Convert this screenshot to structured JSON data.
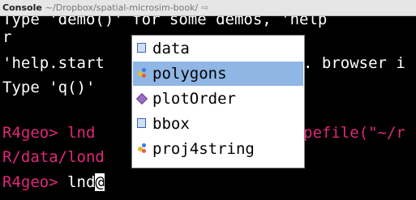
{
  "header": {
    "title": "Console",
    "path": "~/Dropbox/spatial-microsim-book/",
    "goto_icon": "arrow-right-icon"
  },
  "console": {
    "lines": [
      {
        "text": "Type 'demo()' for some demos, 'help",
        "color": "white"
      },
      {
        "text": "r",
        "color": "white"
      },
      {
        "text": "'help.start",
        "tail": ". browser i",
        "color": "white"
      },
      {
        "text": "Type 'q()'",
        "color": "white"
      },
      {
        "text": "",
        "color": "white"
      },
      {
        "text": "R4geo> lnd",
        "tail": "pefile(\"~/r",
        "color": "red"
      },
      {
        "text": "R/data/lond",
        "color": "red"
      },
      {
        "prompt": "R4geo> ",
        "input": "lnd@",
        "color": "red"
      }
    ]
  },
  "autocomplete": {
    "items": [
      {
        "label": "data",
        "icon": "slot-icon"
      },
      {
        "label": "polygons",
        "icon": "object-icon",
        "selected": true
      },
      {
        "label": "plotOrder",
        "icon": "variable-icon"
      },
      {
        "label": "bbox",
        "icon": "slot-icon"
      },
      {
        "label": "proj4string",
        "icon": "object-icon"
      }
    ]
  },
  "colors": {
    "prompt": "#e0287a",
    "selection": "#8fb6e4",
    "header_bg": "#e6e6e6"
  }
}
